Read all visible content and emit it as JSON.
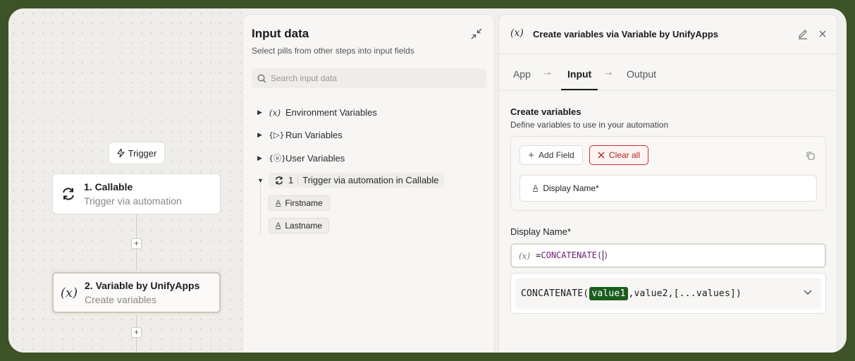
{
  "canvas": {
    "trigger_pill": "Trigger",
    "nodes": [
      {
        "title": "1. Callable",
        "subtitle": "Trigger via automation",
        "icon": "refresh-icon"
      },
      {
        "title": "2. Variable by UnifyApps",
        "subtitle": "Create variables",
        "icon": "variable-icon"
      }
    ],
    "add_step_label": "+"
  },
  "input_panel": {
    "title": "Input data",
    "subtitle": "Select pills from other steps into input fields",
    "search_placeholder": "Search input data",
    "tree": [
      {
        "label": "Environment Variables",
        "icon": "(x)"
      },
      {
        "label": "Run Variables",
        "icon": "{▷}"
      },
      {
        "label": "User Variables",
        "icon": "{ⓤ}"
      }
    ],
    "trigger_step": {
      "num": "1",
      "label": "Trigger via automation in Callable"
    },
    "fields": [
      "Firstname",
      "Lastname"
    ]
  },
  "right_panel": {
    "header_icon": "(x)",
    "title_prefix": "Create variables via ",
    "title_app": "Variable by UnifyApps",
    "tabs": [
      "App",
      "Input",
      "Output"
    ],
    "active_tab": "Input",
    "section_title": "Create variables",
    "section_subtitle": "Define variables to use in your automation",
    "add_field_label": "Add Field",
    "clear_all_label": "Clear all",
    "field_chip": "Display Name*",
    "field_label": "Display Name*",
    "formula_icon": "(x)",
    "formula_eq": "=",
    "formula_fn": "CONCATENATE(",
    "formula_close": ")",
    "signature": {
      "fn": "CONCATENATE(",
      "highlight": "value1",
      "rest": ",value2,[...values])"
    }
  },
  "colors": {
    "background": "#3d5226",
    "accent_red": "#c5322a",
    "highlight_green": "#1a5d1f",
    "formula_purple": "#6a1b70"
  }
}
